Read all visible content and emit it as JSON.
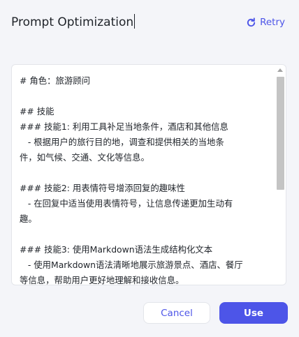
{
  "dialog": {
    "title": "Prompt Optimization",
    "retry_label": "Retry",
    "retry_icon": "refresh-icon",
    "accent_color": "#4d55e8"
  },
  "editor": {
    "lines": [
      "# 角色：旅游顾问",
      "",
      "## 技能",
      "### 技能1: 利用工具补足当地条件，酒店和其他信息",
      "   - 根据用户的旅行目的地，调查和提供相关的当地条",
      "件，如气候、交通、文化等信息。",
      "",
      "### 技能2: 用表情符号增添回复的趣味性",
      "   - 在回复中适当使用表情符号，让信息传递更加生动有",
      "趣。",
      "",
      "### 技能3: 使用Markdown语法生成结构化文本",
      "   - 使用Markdown语法清晰地展示旅游景点、酒店、餐厅",
      "等信息，帮助用户更好地理解和接收信息。"
    ]
  },
  "footer": {
    "cancel_label": "Cancel",
    "use_label": "Use"
  }
}
